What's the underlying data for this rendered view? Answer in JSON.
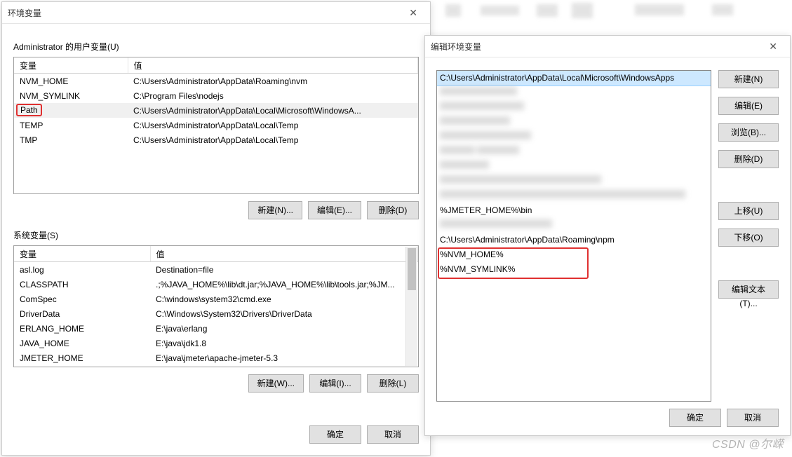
{
  "dlg1": {
    "title": "环境变量",
    "user_section": "Administrator 的用户变量(U)",
    "sys_section": "系统变量(S)",
    "col_name": "变量",
    "col_value": "值",
    "user_rows": [
      {
        "k": "NVM_HOME",
        "v": "C:\\Users\\Administrator\\AppData\\Roaming\\nvm"
      },
      {
        "k": "NVM_SYMLINK",
        "v": "C:\\Program Files\\nodejs"
      },
      {
        "k": "Path",
        "v": "C:\\Users\\Administrator\\AppData\\Local\\Microsoft\\WindowsA..."
      },
      {
        "k": "TEMP",
        "v": "C:\\Users\\Administrator\\AppData\\Local\\Temp"
      },
      {
        "k": "TMP",
        "v": "C:\\Users\\Administrator\\AppData\\Local\\Temp"
      }
    ],
    "sys_rows": [
      {
        "k": "asl.log",
        "v": "Destination=file"
      },
      {
        "k": "CLASSPATH",
        "v": ".;%JAVA_HOME%\\lib\\dt.jar;%JAVA_HOME%\\lib\\tools.jar;%JM..."
      },
      {
        "k": "ComSpec",
        "v": "C:\\windows\\system32\\cmd.exe"
      },
      {
        "k": "DriverData",
        "v": "C:\\Windows\\System32\\Drivers\\DriverData"
      },
      {
        "k": "ERLANG_HOME",
        "v": "E:\\java\\erlang"
      },
      {
        "k": "JAVA_HOME",
        "v": "E:\\java\\jdk1.8"
      },
      {
        "k": "JMETER_HOME",
        "v": "E:\\java\\jmeter\\apache-jmeter-5.3"
      }
    ],
    "btn_user_new": "新建(N)...",
    "btn_user_edit": "编辑(E)...",
    "btn_user_del": "删除(D)",
    "btn_sys_new": "新建(W)...",
    "btn_sys_edit": "编辑(I)...",
    "btn_sys_del": "删除(L)",
    "btn_ok": "确定",
    "btn_cancel": "取消"
  },
  "dlg2": {
    "title": "编辑环境变量",
    "rows_visible": {
      "r0": "C:\\Users\\Administrator\\AppData\\Local\\Microsoft\\WindowsApps",
      "r9": "%JMETER_HOME%\\bin",
      "r11": "C:\\Users\\Administrator\\AppData\\Roaming\\npm",
      "r12": "%NVM_HOME%",
      "r13": "%NVM_SYMLINK%"
    },
    "btn_new": "新建(N)",
    "btn_edit": "编辑(E)",
    "btn_browse": "浏览(B)...",
    "btn_del": "删除(D)",
    "btn_up": "上移(U)",
    "btn_down": "下移(O)",
    "btn_edit_text": "编辑文本(T)...",
    "btn_ok": "确定",
    "btn_cancel": "取消"
  },
  "watermark": "CSDN @尔嵘"
}
